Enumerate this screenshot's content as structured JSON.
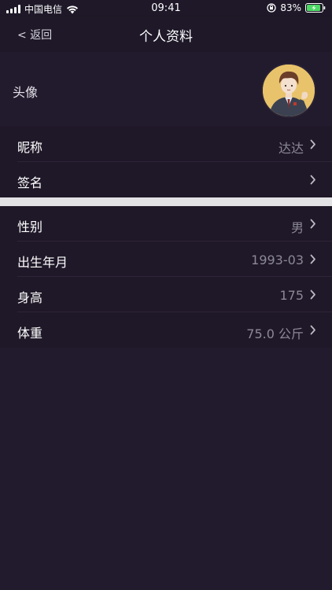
{
  "status_bar": {
    "carrier": "中国电信",
    "time": "09:41",
    "battery_percent": "83%",
    "icons": [
      "signal-icon",
      "wifi-icon",
      "orientation-lock-icon",
      "battery-charging-icon"
    ]
  },
  "nav": {
    "back_label": "< 返回",
    "title": "个人资料"
  },
  "avatar_row": {
    "label": "头像"
  },
  "group1": [
    {
      "label": "昵称",
      "value": "达达"
    },
    {
      "label": "签名",
      "value": ""
    }
  ],
  "group2": [
    {
      "label": "性别",
      "value": "男"
    },
    {
      "label": "出生年月",
      "value": "1993-03"
    },
    {
      "label": "身高",
      "value": "175"
    },
    {
      "label": "体重",
      "value": "75.0 公斤"
    }
  ],
  "colors": {
    "background": "#221a2d",
    "list_background": "#1f1828",
    "value_text": "#8c8896",
    "separator": "#e2e1e4"
  }
}
